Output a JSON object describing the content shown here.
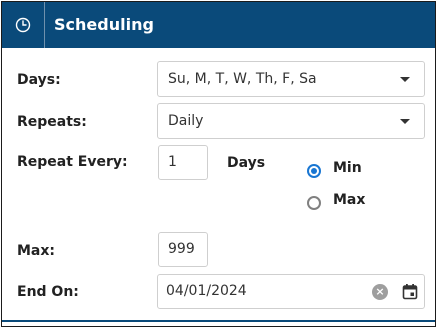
{
  "header": {
    "title": "Scheduling",
    "icon": "clock-icon"
  },
  "form": {
    "days": {
      "label": "Days:",
      "value": "Su, M, T, W, Th, F, Sa"
    },
    "repeats": {
      "label": "Repeats:",
      "value": "Daily"
    },
    "repeat_every": {
      "label": "Repeat Every:",
      "value": "1",
      "unit": "Days"
    },
    "limit_mode": {
      "options": [
        "Min",
        "Max"
      ],
      "selected": "Min"
    },
    "max": {
      "label": "Max:",
      "value": "999"
    },
    "end_on": {
      "label": "End On:",
      "value": "04/01/2024"
    }
  },
  "colors": {
    "header_bg": "#0a4a7a",
    "radio_accent": "#1976d2"
  }
}
